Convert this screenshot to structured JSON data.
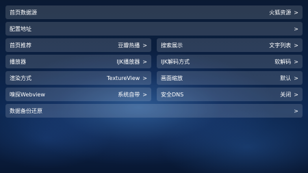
{
  "settings": {
    "home_source": {
      "label": "首页数据源",
      "value": "火狐资源"
    },
    "config_url": {
      "label": "配置地址",
      "value": ""
    },
    "home_recommend": {
      "label": "首页推荐",
      "value": "豆瓣热播"
    },
    "search_display": {
      "label": "搜索展示",
      "value": "文字列表"
    },
    "player": {
      "label": "播放器",
      "value": "IJK播放器"
    },
    "ijk_decode": {
      "label": "IJK解码方式",
      "value": "软解码"
    },
    "render_mode": {
      "label": "渲染方式",
      "value": "TextureView"
    },
    "scale": {
      "label": "画面缩放",
      "value": "默认"
    },
    "sniff_webview": {
      "label": "嗅探Webview",
      "value": "系统自带"
    },
    "secure_dns": {
      "label": "安全DNS",
      "value": "关闭"
    },
    "backup_restore": {
      "label": "数据备份还原",
      "value": ""
    }
  },
  "chevron": ">"
}
